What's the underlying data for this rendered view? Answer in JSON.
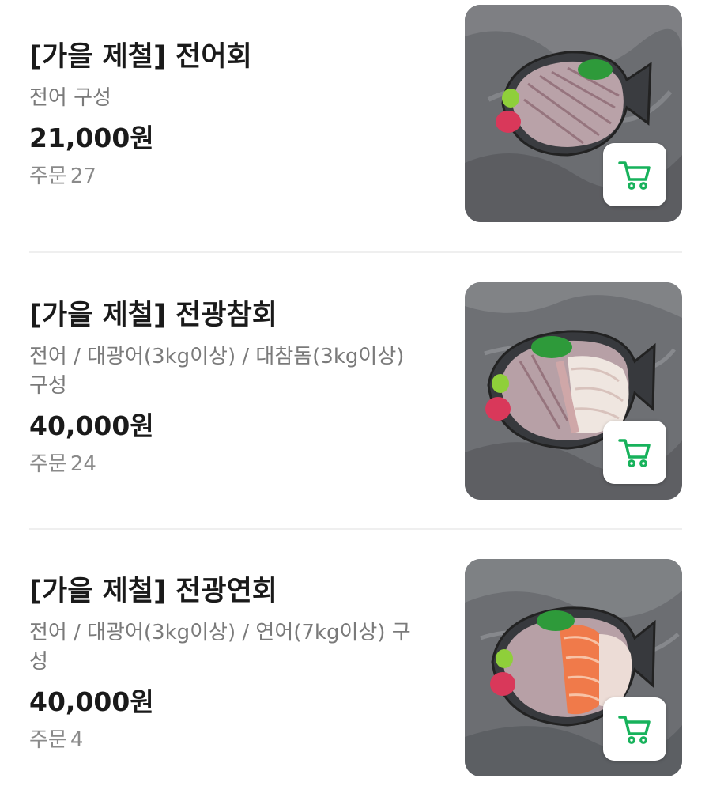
{
  "colors": {
    "accent": "#17b25b",
    "title_text": "#1a1a1a",
    "sub_text": "#7a7a7a"
  },
  "menu_items": [
    {
      "title": "[가을 제철] 전어회",
      "description": "전어 구성",
      "price": "21,000원",
      "orders_label": "주문",
      "orders_count": "27",
      "image_icon": "sashimi-platter-image",
      "cart_icon": "shopping-cart-icon"
    },
    {
      "title": "[가을 제철] 전광참회",
      "description": "전어 / 대광어(3kg이상) / 대참돔(3kg이상) 구성",
      "price": "40,000원",
      "orders_label": "주문",
      "orders_count": "24",
      "image_icon": "sashimi-platter-image",
      "cart_icon": "shopping-cart-icon"
    },
    {
      "title": "[가을 제철] 전광연회",
      "description": "전어 / 대광어(3kg이상) / 연어(7kg이상) 구성",
      "price": "40,000원",
      "orders_label": "주문",
      "orders_count": "4",
      "image_icon": "sashimi-platter-image",
      "cart_icon": "shopping-cart-icon"
    }
  ]
}
